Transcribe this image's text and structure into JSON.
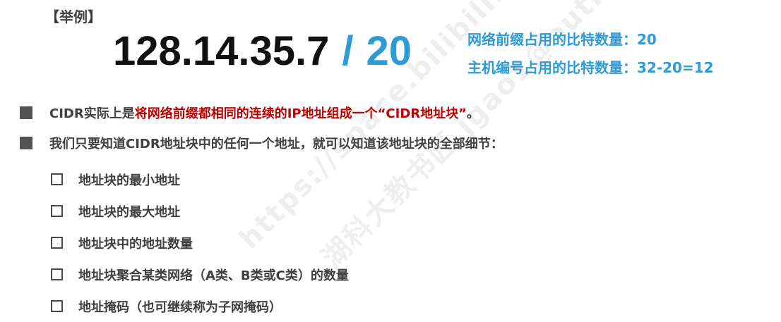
{
  "example": {
    "label": "【举例】"
  },
  "cidr": {
    "ip": "128.14.35.7",
    "slash": "/",
    "prefix": "20"
  },
  "notes": {
    "prefix_bits_label": "网络前缀占用的比特数量：",
    "prefix_bits_value": "20",
    "host_bits_label": "主机编号占用的比特数量：",
    "host_bits_value": "32-20=12"
  },
  "bullets": {
    "b1_prefix": "CIDR实际上是",
    "b1_highlight": "将网络前缀都相同的连续的IP地址组成一个“CIDR地址块”",
    "b1_suffix": "。",
    "b2_text": "我们只要知道CIDR地址块中的任何一个地址，就可以知道该地址块的全部细节："
  },
  "sub_items": [
    "地址块的最小地址",
    "地址块的最大地址",
    "地址块中的地址数量",
    "地址块聚合某类网络（A类、B类或C类）的数量",
    "地址掩码（也可继续称为子网掩码）"
  ],
  "watermark": {
    "text_1": "https://space.bilibili.com/360",
    "text_2": "湖科大教书匠 jgao1@outlook"
  },
  "colors": {
    "accent_blue": "#2e9bd6",
    "highlight_red": "#c00000",
    "text_gray": "#404040"
  }
}
